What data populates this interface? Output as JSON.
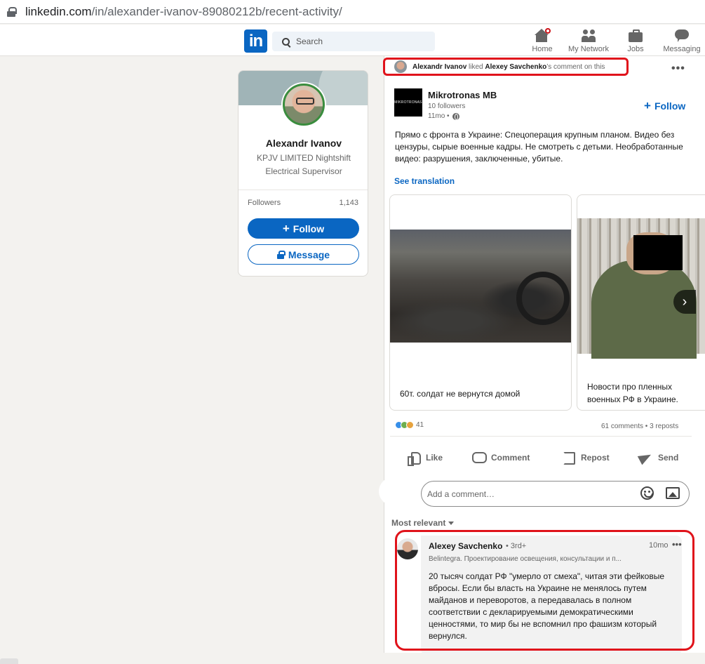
{
  "browser": {
    "url_domain": "linkedin.com",
    "url_path": "/in/alexander-ivanov-89080212b/recent-activity/"
  },
  "nav": {
    "logo": "in",
    "search_placeholder": "Search",
    "items": [
      {
        "label": "Home",
        "icon": "home-icon",
        "has_badge": true
      },
      {
        "label": "My Network",
        "icon": "network-icon"
      },
      {
        "label": "Jobs",
        "icon": "briefcase-icon"
      },
      {
        "label": "Messaging",
        "icon": "message-icon"
      }
    ]
  },
  "profile": {
    "name": "Alexandr Ivanov",
    "headline": "KPJV LIMITED Nightshift Electrical Supervisor",
    "followers_label": "Followers",
    "followers_count": "1,143",
    "follow_label": "Follow",
    "message_label": "Message"
  },
  "activity": {
    "actor": "Alexandr Ivanov",
    "verb": "liked",
    "target": "Alexey Savchenko",
    "suffix": "’s comment on this"
  },
  "post": {
    "author": "Mikrotronas MB",
    "logo_text": "MIKROTRONAS",
    "followers": "10 followers",
    "time": "11mo •",
    "follow_label": "Follow",
    "text": "Прямо с фронта в Украине: Спецоперация крупным планом. Видео без цензуры, сырые военные кадры. Не смотреть с детьми. Необработанные видео: разрушения, заключенные, убитые.",
    "see_translation": "See translation",
    "cards": [
      {
        "caption": "60т. солдат не вернутся домой"
      },
      {
        "caption": "Новости про пленных военных РФ в Украине."
      }
    ],
    "reaction_count": "41",
    "stats": "61 comments • 3 reposts",
    "actions": {
      "like": "Like",
      "comment": "Comment",
      "repost": "Repost",
      "send": "Send"
    },
    "comment_placeholder": "Add a comment…",
    "sort_label": "Most relevant"
  },
  "comment": {
    "author": "Alexey Savchenko",
    "degree": "• 3rd+",
    "time": "10mo",
    "subtitle": "Belintegra. Проектирование освещения, консультации и п...",
    "text": "20 тысяч солдат РФ \"умерло от смеха\", читая эти фейковые вбросы. Если бы власть на Украине не менялось путем майданов и переворотов, а передавалась в полном соответствии с декларируемыми демократическими ценностями, то мир бы не вспомнил про фашизм который вернулся."
  },
  "colors": {
    "brand": "#0a66c2",
    "highlight": "#e0131b",
    "background": "#f3f2ef"
  }
}
